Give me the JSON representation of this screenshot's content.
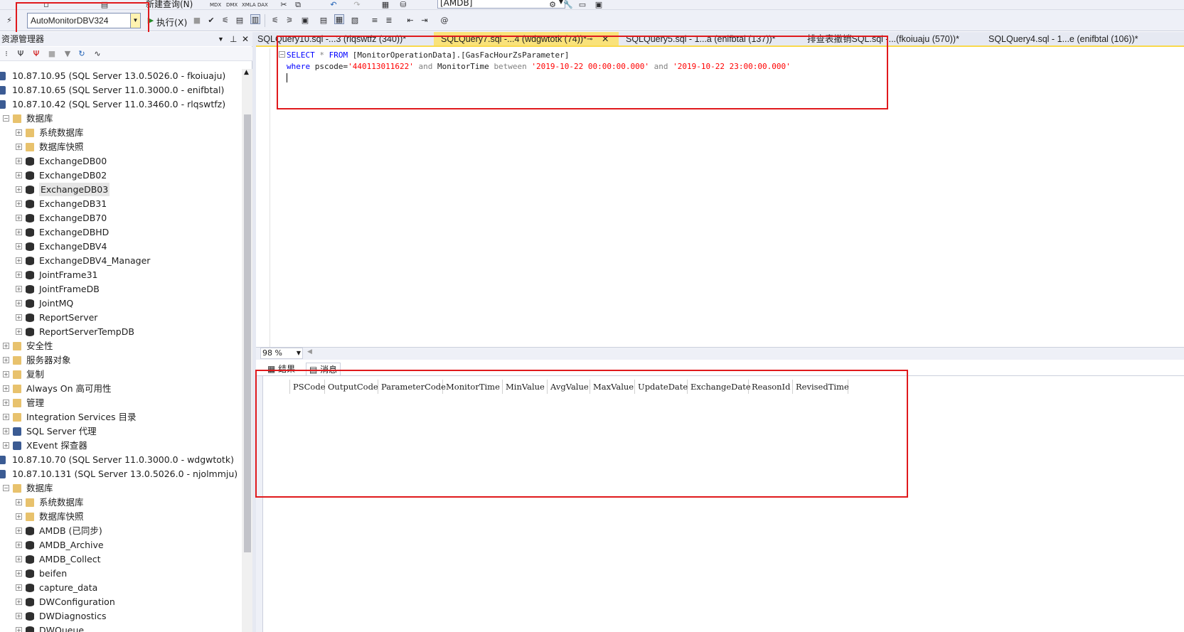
{
  "toolbar": {
    "new_query_label": "新建查询(N)",
    "execute_label": "执行(X)",
    "current_database": "AutoMonitorDBV324",
    "top_database": "[AMDB]"
  },
  "object_explorer": {
    "title": "资源管理器",
    "tree": [
      {
        "label": "10.87.10.95 (SQL Server 13.0.5026.0 - fkoiuaju)",
        "type": "server",
        "level": 0
      },
      {
        "label": "10.87.10.65 (SQL Server 11.0.3000.0 - enifbtal)",
        "type": "server",
        "level": 0
      },
      {
        "label": "10.87.10.42 (SQL Server 11.0.3460.0 - rlqswtfz)",
        "type": "server",
        "level": 0
      },
      {
        "label": "数据库",
        "type": "folder",
        "level": 1,
        "expanded": true
      },
      {
        "label": "系统数据库",
        "type": "folder",
        "level": 2
      },
      {
        "label": "数据库快照",
        "type": "folder",
        "level": 2
      },
      {
        "label": "ExchangeDB00",
        "type": "db",
        "level": 2
      },
      {
        "label": "ExchangeDB02",
        "type": "db",
        "level": 2
      },
      {
        "label": "ExchangeDB03",
        "type": "db",
        "level": 2,
        "highlighted": true
      },
      {
        "label": "ExchangeDB31",
        "type": "db",
        "level": 2
      },
      {
        "label": "ExchangeDB70",
        "type": "db",
        "level": 2
      },
      {
        "label": "ExchangeDBHD",
        "type": "db",
        "level": 2
      },
      {
        "label": "ExchangeDBV4",
        "type": "db",
        "level": 2
      },
      {
        "label": "ExchangeDBV4_Manager",
        "type": "db",
        "level": 2
      },
      {
        "label": "JointFrame31",
        "type": "db",
        "level": 2
      },
      {
        "label": "JointFrameDB",
        "type": "db",
        "level": 2
      },
      {
        "label": "JointMQ",
        "type": "db",
        "level": 2
      },
      {
        "label": "ReportServer",
        "type": "db",
        "level": 2
      },
      {
        "label": "ReportServerTempDB",
        "type": "db",
        "level": 2
      },
      {
        "label": "安全性",
        "type": "folder",
        "level": 1
      },
      {
        "label": "服务器对象",
        "type": "folder",
        "level": 1
      },
      {
        "label": "复制",
        "type": "folder",
        "level": 1
      },
      {
        "label": "Always On 高可用性",
        "type": "folder",
        "level": 1
      },
      {
        "label": "管理",
        "type": "folder",
        "level": 1
      },
      {
        "label": "Integration Services 目录",
        "type": "folder",
        "level": 1
      },
      {
        "label": "SQL Server 代理",
        "type": "agent",
        "level": 1
      },
      {
        "label": "XEvent 探查器",
        "type": "xevent",
        "level": 1
      },
      {
        "label": "10.87.10.70 (SQL Server 11.0.3000.0 - wdgwtotk)",
        "type": "server",
        "level": 0
      },
      {
        "label": "10.87.10.131 (SQL Server 13.0.5026.0 - njolmmju)",
        "type": "server",
        "level": 0
      },
      {
        "label": "数据库",
        "type": "folder",
        "level": 1,
        "expanded": true
      },
      {
        "label": "系统数据库",
        "type": "folder",
        "level": 2
      },
      {
        "label": "数据库快照",
        "type": "folder",
        "level": 2
      },
      {
        "label": "AMDB (已同步)",
        "type": "db",
        "level": 2
      },
      {
        "label": "AMDB_Archive",
        "type": "db",
        "level": 2
      },
      {
        "label": "AMDB_Collect",
        "type": "db",
        "level": 2
      },
      {
        "label": "beifen",
        "type": "db",
        "level": 2
      },
      {
        "label": "capture_data",
        "type": "db",
        "level": 2
      },
      {
        "label": "DWConfiguration",
        "type": "db",
        "level": 2
      },
      {
        "label": "DWDiagnostics",
        "type": "db",
        "level": 2
      },
      {
        "label": "DWQueue",
        "type": "db",
        "level": 2
      }
    ]
  },
  "tabs": [
    {
      "label": "SQLQuery10.sql -...3 (rlqswtfz (340))*",
      "active": false
    },
    {
      "label": "SQLQuery7.sql -...4 (wdgwtotk (74))*",
      "active": true
    },
    {
      "label": "SQLQuery5.sql - 1...a (enifbtal (137))*",
      "active": false
    },
    {
      "label": "排查表撤销SQL.sql -...(fkoiuaju (570))*",
      "active": false
    },
    {
      "label": "SQLQuery4.sql - 1...e (enifbtal (106))*",
      "active": false
    }
  ],
  "editor": {
    "line1": {
      "select": "SELECT",
      "star": "*",
      "from": "FROM",
      "object": "[MonitorOperationData].[GasFacHourZsParameter]"
    },
    "line2": {
      "where": "where",
      "col1": "pscode=",
      "val1": "'440113011622'",
      "and1": "and",
      "col2": "MonitorTime",
      "between": "between",
      "val2": "'2019-10-22 00:00:00.000'",
      "and2": "and",
      "val3": "'2019-10-22 23:00:00.000'"
    }
  },
  "zoom": "98 %",
  "result_tabs": {
    "results": "结果",
    "messages": "消息"
  },
  "results": {
    "columns": [
      "PSCode",
      "OutputCode",
      "ParameterCode",
      "MonitorTime",
      "MinValue",
      "AvgValue",
      "MaxValue",
      "UpdateDate",
      "ExchangeDate",
      "ReasonId",
      "RevisedTime"
    ]
  },
  "colors": {
    "highlight_box": "#e0191c",
    "active_tab": "#f9e27a",
    "keyword": "#0000ff",
    "string": "#ff0000"
  }
}
